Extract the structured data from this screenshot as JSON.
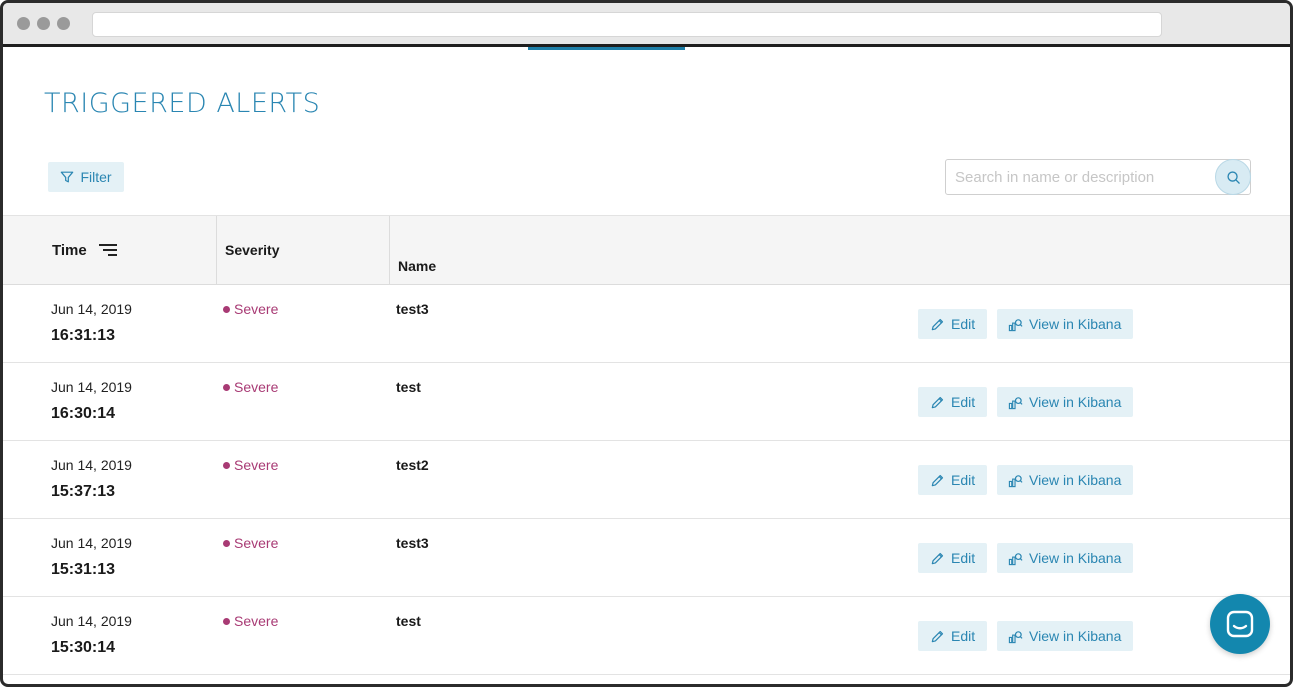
{
  "page": {
    "title": "TRIGGERED ALERTS"
  },
  "toolbar": {
    "filter_label": "Filter",
    "search_placeholder": "Search in name or description",
    "search_value": ""
  },
  "table": {
    "columns": {
      "time": "Time",
      "severity": "Severity",
      "name": "Name"
    },
    "rows": [
      {
        "date": "Jun 14, 2019",
        "time": "16:31:13",
        "severity": "Severe",
        "name": "test3",
        "edit_label": "Edit",
        "kibana_label": "View in Kibana"
      },
      {
        "date": "Jun 14, 2019",
        "time": "16:30:14",
        "severity": "Severe",
        "name": "test",
        "edit_label": "Edit",
        "kibana_label": "View in Kibana"
      },
      {
        "date": "Jun 14, 2019",
        "time": "15:37:13",
        "severity": "Severe",
        "name": "test2",
        "edit_label": "Edit",
        "kibana_label": "View in Kibana"
      },
      {
        "date": "Jun 14, 2019",
        "time": "15:31:13",
        "severity": "Severe",
        "name": "test3",
        "edit_label": "Edit",
        "kibana_label": "View in Kibana"
      },
      {
        "date": "Jun 14, 2019",
        "time": "15:30:14",
        "severity": "Severe",
        "name": "test",
        "edit_label": "Edit",
        "kibana_label": "View in Kibana"
      }
    ]
  },
  "colors": {
    "accent": "#2a86b2",
    "button_bg": "#e4f1f6",
    "severity_severe": "#a83a74",
    "chat_button": "#1387ae"
  },
  "icons": {
    "filter": "filter-icon",
    "search": "search-icon",
    "sort": "sort-icon",
    "edit": "pencil-icon",
    "kibana": "kibana-icon",
    "chat": "chat-icon"
  }
}
